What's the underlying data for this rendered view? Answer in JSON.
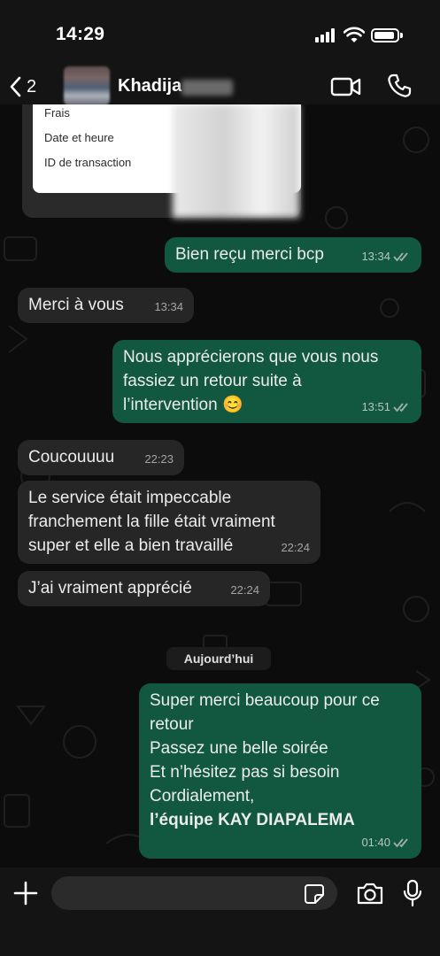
{
  "status_bar": {
    "time": "14:29"
  },
  "header": {
    "back_count": "2",
    "contact_name": "Khadija"
  },
  "receipt": {
    "rows": [
      "Frais",
      "Date et heure",
      "ID de transaction"
    ]
  },
  "messages": [
    {
      "direction": "out",
      "text": "Bien reçu merci bcp",
      "time": "13:34",
      "read": true
    },
    {
      "direction": "in",
      "text": "Merci à vous",
      "time": "13:34"
    },
    {
      "direction": "out",
      "lines": [
        "Nous apprécierons que vous nous",
        "fassiez un retour suite à",
        "l’intervention 😊"
      ],
      "time": "13:51",
      "read": true
    },
    {
      "direction": "in",
      "text": "Coucouuuu",
      "time": "22:23"
    },
    {
      "direction": "in",
      "lines": [
        "Le service était impeccable",
        "franchement la fille était vraiment",
        "super et elle a bien travaillé"
      ],
      "time": "22:24"
    },
    {
      "direction": "in",
      "text": "J’ai vraiment apprécié",
      "time": "22:24"
    },
    {
      "direction": "out",
      "lines": [
        "Super merci beaucoup pour ce",
        "retour",
        "Passez une belle soirée",
        "Et n’hésitez pas si besoin",
        "Cordialement,",
        "l’équipe KAY DIAPALEMA"
      ],
      "bold_last_line": true,
      "time": "01:40",
      "read": true
    }
  ],
  "day_separator": "Aujourd’hui",
  "composer": {
    "placeholder": ""
  },
  "colors": {
    "outgoing_bubble": "#125840",
    "incoming_bubble": "#262626",
    "read_ticks": "#9fb0a8"
  }
}
